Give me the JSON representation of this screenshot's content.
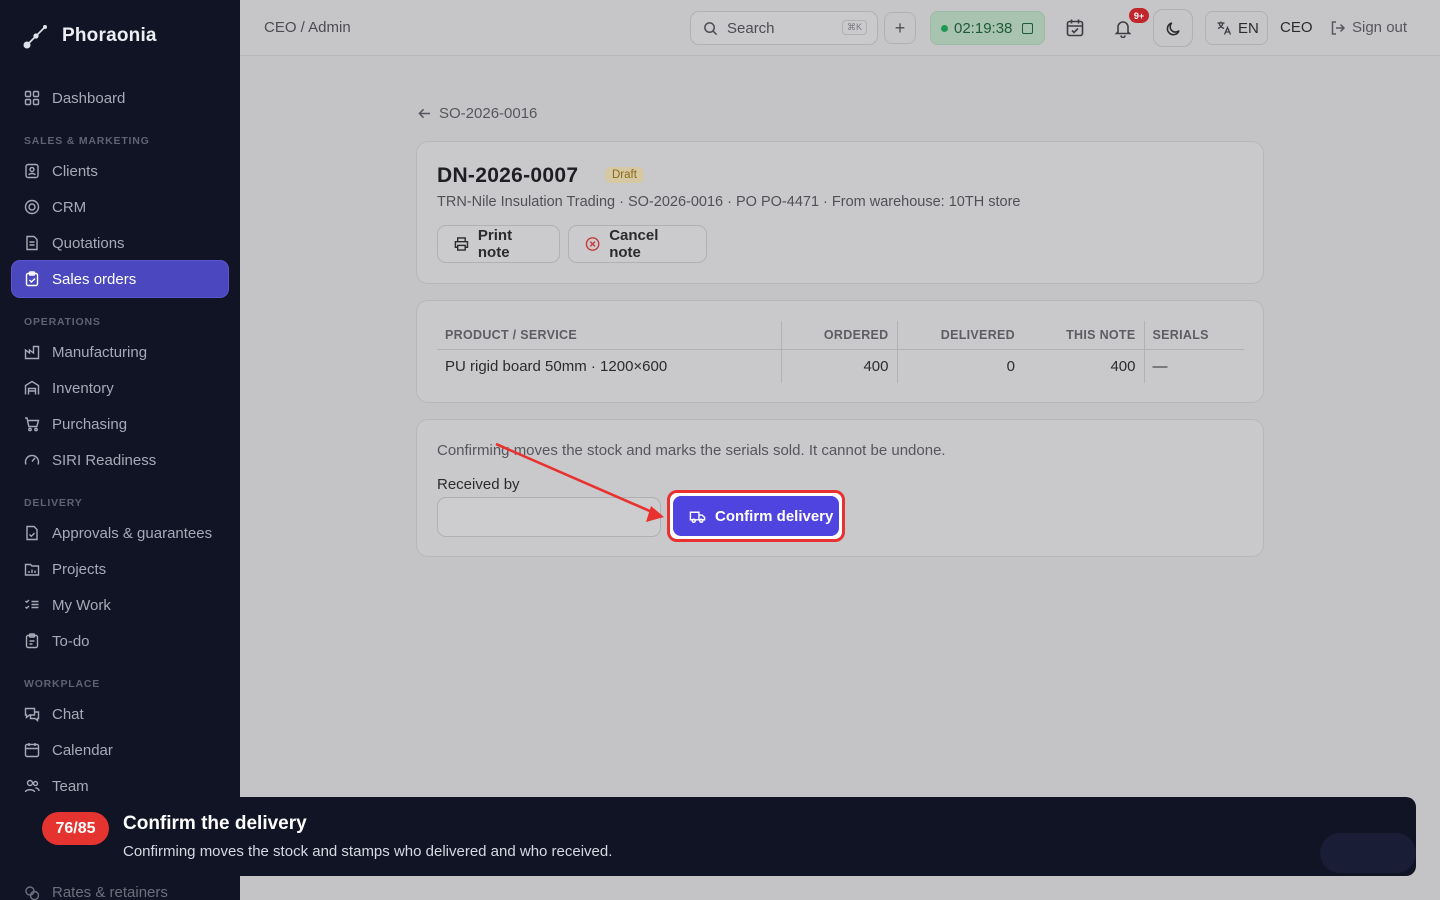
{
  "app": {
    "name": "Phoraonia"
  },
  "sidebar": {
    "dashboard": "Dashboard",
    "sections": {
      "sales": "SALES & MARKETING",
      "operations": "OPERATIONS",
      "delivery": "DELIVERY",
      "workplace": "WORKPLACE"
    },
    "sales_items": [
      "Clients",
      "CRM",
      "Quotations",
      "Sales orders"
    ],
    "operations_items": [
      "Manufacturing",
      "Inventory",
      "Purchasing",
      "SIRI Readiness"
    ],
    "delivery_items": [
      "Approvals & guarantees",
      "Projects",
      "My Work",
      "To-do"
    ],
    "workplace_items": [
      "Chat",
      "Calendar",
      "Team"
    ],
    "footer_item": "Rates & retainers",
    "active_item": "Sales orders"
  },
  "topbar": {
    "breadcrumb": "CEO / Admin",
    "search_placeholder": "Search",
    "search_shortcut": "⌘K",
    "timer": "02:19:38",
    "notification_count": "9+",
    "language": "EN",
    "role": "CEO",
    "sign_out": "Sign out"
  },
  "page": {
    "back_label": "SO-2026-0016",
    "doc_number": "DN-2026-0007",
    "status": "Draft",
    "meta": "TRN-Nile Insulation Trading · SO-2026-0016 · PO PO-4471 · From warehouse: 10TH store",
    "print_label": "Print note",
    "cancel_label": "Cancel note"
  },
  "table": {
    "headers": [
      "PRODUCT / SERVICE",
      "ORDERED",
      "DELIVERED",
      "THIS NOTE",
      "SERIALS"
    ],
    "rows": [
      {
        "product": "PU rigid board 50mm · 1200×600",
        "ordered": "400",
        "delivered": "0",
        "this_note": "400",
        "serials": "—"
      }
    ]
  },
  "confirm": {
    "warning": "Confirming moves the stock and marks the serials sold. It cannot be undone.",
    "received_by_label": "Received by",
    "received_by_value": "",
    "button_label": "Confirm delivery"
  },
  "tour": {
    "step": "76/85",
    "title": "Confirm the delivery",
    "description": "Confirming moves the stock and stamps who delivered and who received."
  },
  "colors": {
    "sidebar_bg": "#111425",
    "accent": "#5044e0",
    "highlight": "#e8322f",
    "timer_green": "#1c9a55"
  }
}
